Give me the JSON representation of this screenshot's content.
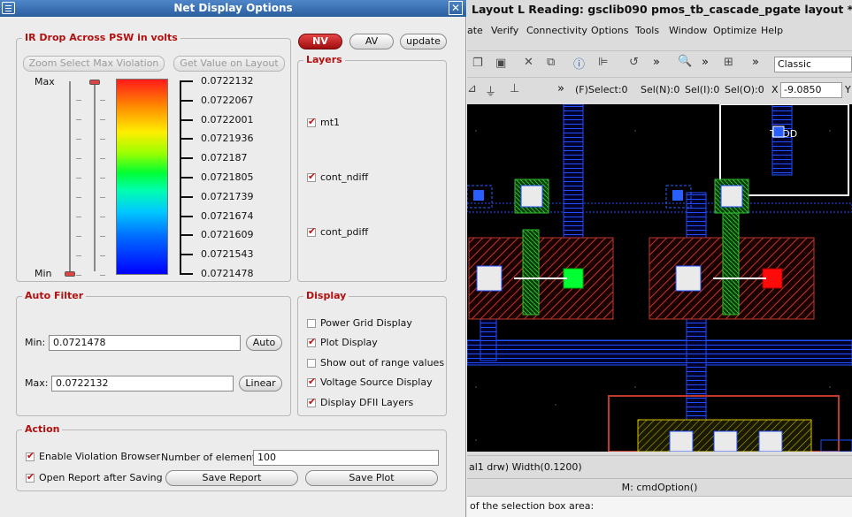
{
  "dialog": {
    "title": "Net Display Options",
    "close_glyph": "✕",
    "ir_drop": {
      "title": "IR Drop Across PSW in volts",
      "zoom_button": "Zoom Select Max Violation",
      "get_value_button": "Get Value on Layout",
      "max_label": "Max",
      "min_label": "Min",
      "scale_values": [
        "0.0722132",
        "0.0722067",
        "0.0722001",
        "0.0721936",
        "0.072187",
        "0.0721805",
        "0.0721739",
        "0.0721674",
        "0.0721609",
        "0.0721543",
        "0.0721478"
      ]
    },
    "buttons": {
      "nv": "NV",
      "av": "AV",
      "update": "update"
    },
    "layers": {
      "title": "Layers",
      "items": [
        {
          "label": "mt1",
          "checked": true
        },
        {
          "label": "cont_ndiff",
          "checked": true
        },
        {
          "label": "cont_pdiff",
          "checked": true
        }
      ]
    },
    "auto_filter": {
      "title": "Auto Filter",
      "min_label": "Min:",
      "min_value": "0.0721478",
      "max_label": "Max:",
      "max_value": "0.0722132",
      "auto_button": "Auto",
      "linear_button": "Linear"
    },
    "display": {
      "title": "Display",
      "items": [
        {
          "label": "Power Grid Display",
          "checked": false
        },
        {
          "label": "Plot Display",
          "checked": true
        },
        {
          "label": "Show out of range values",
          "checked": false
        },
        {
          "label": "Voltage Source Display",
          "checked": true
        },
        {
          "label": "Display DFII Layers",
          "checked": true
        }
      ]
    },
    "action": {
      "title": "Action",
      "enable_violation": "Enable Violation Browser",
      "open_report": "Open Report after Saving",
      "num_elements_label": "Number of elements",
      "num_elements_value": "100",
      "save_report": "Save Report",
      "save_plot": "Save Plot"
    }
  },
  "layout_window": {
    "title": "Layout L Reading: gsclib090 pmos_tb_cascade_pgate layout *",
    "menu": [
      "ate",
      "Verify",
      "Connectivity",
      "Options",
      "Tools",
      "Window",
      "Optimize",
      "Help"
    ],
    "toolbar_select": "Classic",
    "status_bar": {
      "select_f": "(F)Select:0",
      "sel_n": "Sel(N):0",
      "sel_i": "Sel(I):0",
      "sel_o": "Sel(O):0",
      "x_label": "X",
      "x_value": "-9.0850",
      "y_label": "Y"
    },
    "canvas_label": "TVDD",
    "bottom_status": "al1 drw)     Width(0.1200)",
    "cmd_status": "M: cmdOption()",
    "prompt": "of the selection box area:"
  },
  "colors": {
    "title_bar": "#2a5f9f",
    "group_title": "#b01010",
    "nv_button": "#c01818",
    "canvas_bg": "#000000",
    "hatch_red": "#c0392b",
    "metal_blue": "#1f4fff",
    "poly_green": "#20b020"
  }
}
